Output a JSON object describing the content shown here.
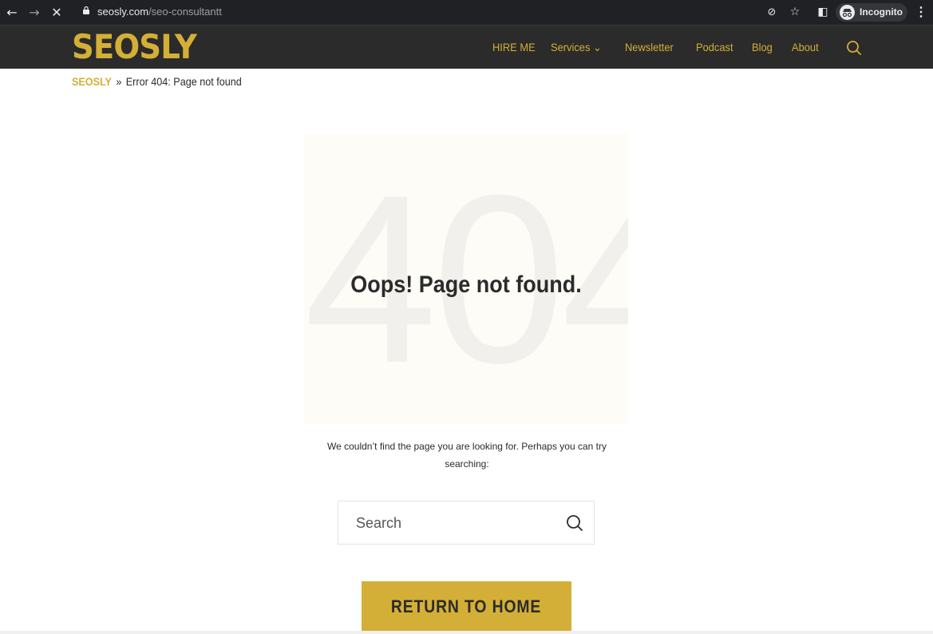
{
  "browser": {
    "back_icon": "←",
    "forward_icon": "→",
    "stop_icon": "✕",
    "url_domain": "seosly.com",
    "url_path": "/seo-consultantt",
    "eye_off_icon": "⊘",
    "star_icon": "☆",
    "sidepanel_icon": "◧",
    "incognito_label": "Incognito",
    "menu_icon": "⋮"
  },
  "header": {
    "logo_text": "SEOSLY",
    "nav": [
      {
        "label": "HIRE ME"
      },
      {
        "label": "Services ⌄"
      },
      {
        "label": "Newsletter"
      },
      {
        "label": "Podcast"
      },
      {
        "label": "Blog"
      },
      {
        "label": "About"
      }
    ]
  },
  "breadcrumb": {
    "home": "SEOSLY",
    "separator": "»",
    "current": "Error 404: Page not found"
  },
  "hero": {
    "background_text": "404",
    "title": "Oops! Page not found."
  },
  "message": "We couldn’t find the page you are looking for. Perhaps you can try searching:",
  "search": {
    "placeholder": "Search"
  },
  "home_button": {
    "label": "RETURN TO HOME"
  },
  "colors": {
    "brand_gold": "#d4af37",
    "header_bg": "#2b2b2b",
    "text_dark": "#2b2b2b"
  }
}
